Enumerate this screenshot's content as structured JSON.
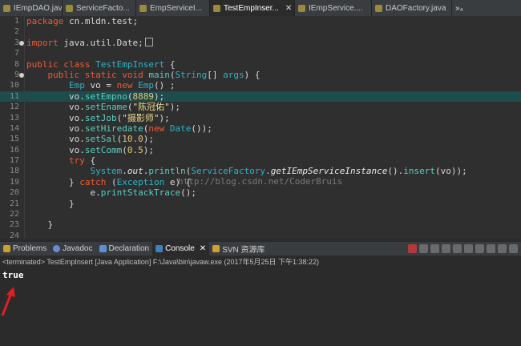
{
  "editor_tabs": [
    {
      "label": "IEmpDAO.java",
      "active": false
    },
    {
      "label": "ServiceFacto...",
      "active": false
    },
    {
      "label": "EmpServiceI...",
      "active": false
    },
    {
      "label": "TestEmpInser...",
      "active": true,
      "close": "✕"
    },
    {
      "label": "IEmpService....",
      "active": false
    },
    {
      "label": "DAOFactory.java",
      "active": false
    }
  ],
  "overflow_tab": "»₄",
  "code_lines": [
    {
      "num": "1"
    },
    {
      "num": "2"
    },
    {
      "num": "3"
    },
    {
      "num": "7"
    },
    {
      "num": "8"
    },
    {
      "num": "9"
    },
    {
      "num": "10"
    },
    {
      "num": "11"
    },
    {
      "num": "12"
    },
    {
      "num": "13"
    },
    {
      "num": "14"
    },
    {
      "num": "15"
    },
    {
      "num": "16"
    },
    {
      "num": "17"
    },
    {
      "num": "18"
    },
    {
      "num": "19"
    },
    {
      "num": "20"
    },
    {
      "num": "21"
    },
    {
      "num": "22"
    },
    {
      "num": "23"
    },
    {
      "num": "24"
    }
  ],
  "code": {
    "l1_kw": "package",
    "l1_rest": " cn.mldn.test;",
    "l3_kw": "import",
    "l3_rest": " java.util.Date;",
    "l8_kw": "public class",
    "l8_name": "TestEmpInsert",
    "l8_rest": " {",
    "l9_kw": "public static void",
    "l9_mt": "main",
    "l9_p1": "(",
    "l9_ty": "String",
    "l9_p2": "[] ",
    "l9_args": "args",
    "l9_p3": ") {",
    "l10_ty": "Emp",
    "l10_var": " vo ",
    "l10_op": "= ",
    "l10_kw": "new",
    "l10_ty2": " Emp",
    "l10_rest": "() ;",
    "l11_a": "vo.",
    "l11_m": "setEmpno",
    "l11_b": "(",
    "l11_n": "8889",
    "l11_c": ");",
    "l12_a": "vo.",
    "l12_m": "setEname",
    "l12_b": "(",
    "l12_s": "\"陈冠佑\"",
    "l12_c": ");",
    "l13_a": "vo.",
    "l13_m": "setJob",
    "l13_b": "(",
    "l13_s": "\"摄影师\"",
    "l13_c": ");",
    "l14_a": "vo.",
    "l14_m": "setHiredate",
    "l14_b": "(",
    "l14_kw": "new",
    "l14_ty": " Date",
    "l14_c": "());",
    "l15_a": "vo.",
    "l15_m": "setSal",
    "l15_b": "(",
    "l15_n": "10.0",
    "l15_c": ");",
    "l16_a": "vo.",
    "l16_m": "setComm",
    "l16_b": "(",
    "l16_n": "0.5",
    "l16_c": ");",
    "l17_kw": "try",
    "l17_rest": " {",
    "l18_ty": "System",
    "l18_a": ".",
    "l18_out": "out",
    "l18_b": ".",
    "l18_m1": "println",
    "l18_c": "(",
    "l18_ty2": "ServiceFactory",
    "l18_d": ".",
    "l18_m2": "getIEmpServiceInstance",
    "l18_e": "().",
    "l18_m3": "insert",
    "l18_f": "(vo));",
    "l19_a": "} ",
    "l19_kw": "catch",
    "l19_b": " (",
    "l19_ty": "Exception",
    "l19_c": " e) {",
    "l20_a": "e.",
    "l20_m": "printStackTrace",
    "l20_b": "();",
    "l21": "}",
    "l23": "}"
  },
  "watermark": "http://blog.csdn.net/CoderBruis",
  "view_tabs": [
    {
      "label": "Problems",
      "icon_color": "#c9a227",
      "active": false
    },
    {
      "label": "Javadoc",
      "icon_color": "#6a8ad8",
      "active": false
    },
    {
      "label": "Declaration",
      "icon_color": "#5b8fd0",
      "active": false
    },
    {
      "label": "Console",
      "icon_color": "#3f7fc0",
      "active": true,
      "close": "✕"
    },
    {
      "label": "SVN 资源库",
      "icon_color": "#d0a030",
      "active": false
    }
  ],
  "console": {
    "status": "<terminated> TestEmpInsert [Java Application] F:\\Java\\bin\\javaw.exe (2017年5月25日 下午1:38:22)",
    "output": "true"
  },
  "colors": {
    "arrow": "#e02020"
  }
}
